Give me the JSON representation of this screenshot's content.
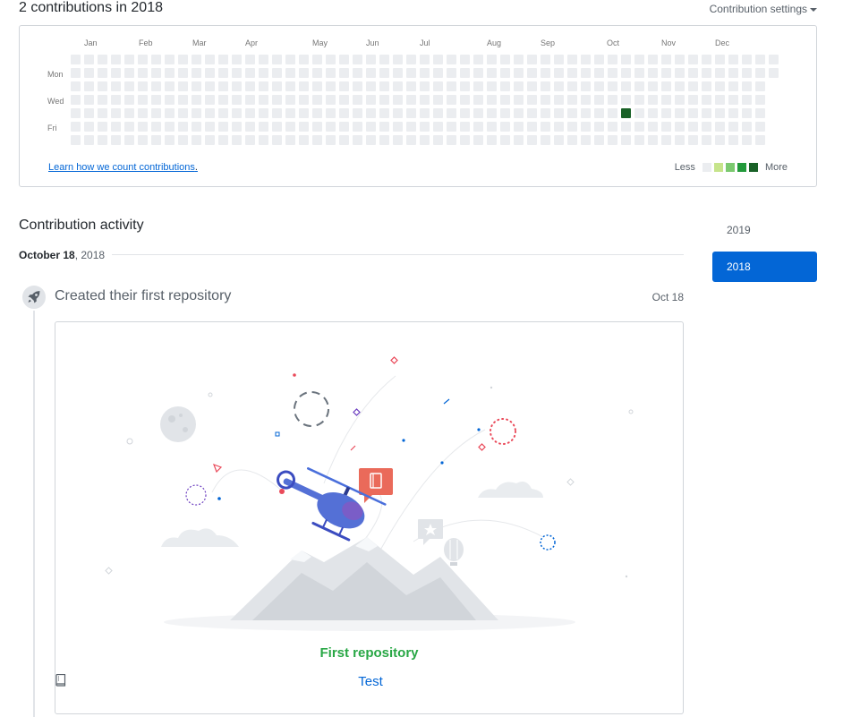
{
  "header": {
    "contrib_title": "2 contributions in 2018",
    "settings_label": "Contribution settings"
  },
  "calendar": {
    "months": [
      "Jan",
      "Feb",
      "Mar",
      "Apr",
      "May",
      "Jun",
      "Jul",
      "Aug",
      "Sep",
      "Oct",
      "Nov",
      "Dec"
    ],
    "days": [
      "Mon",
      "Wed",
      "Fri"
    ],
    "learn_link": "Learn how we count contributions",
    "learn_link_suffix": ".",
    "legend_less": "Less",
    "legend_more": "More",
    "legend_colors": [
      "#ebedf0",
      "#c6e48b",
      "#7bc96f",
      "#239a3b",
      "#196127"
    ],
    "active_color": "#196127",
    "active_cell": {
      "week": 41,
      "day": 4
    }
  },
  "activity": {
    "title": "Contribution activity",
    "date_bold": "October 18",
    "date_sep": ", ",
    "date_year": "2018",
    "event_title": "Created their first repository",
    "event_date": "Oct 18",
    "card_heading": "First repository",
    "repo_name": "Test"
  },
  "years": [
    "2019",
    "2018"
  ],
  "selected_year": "2018",
  "colors": {
    "accent": "#0366d6",
    "success": "#28a745",
    "muted": "#586069"
  }
}
